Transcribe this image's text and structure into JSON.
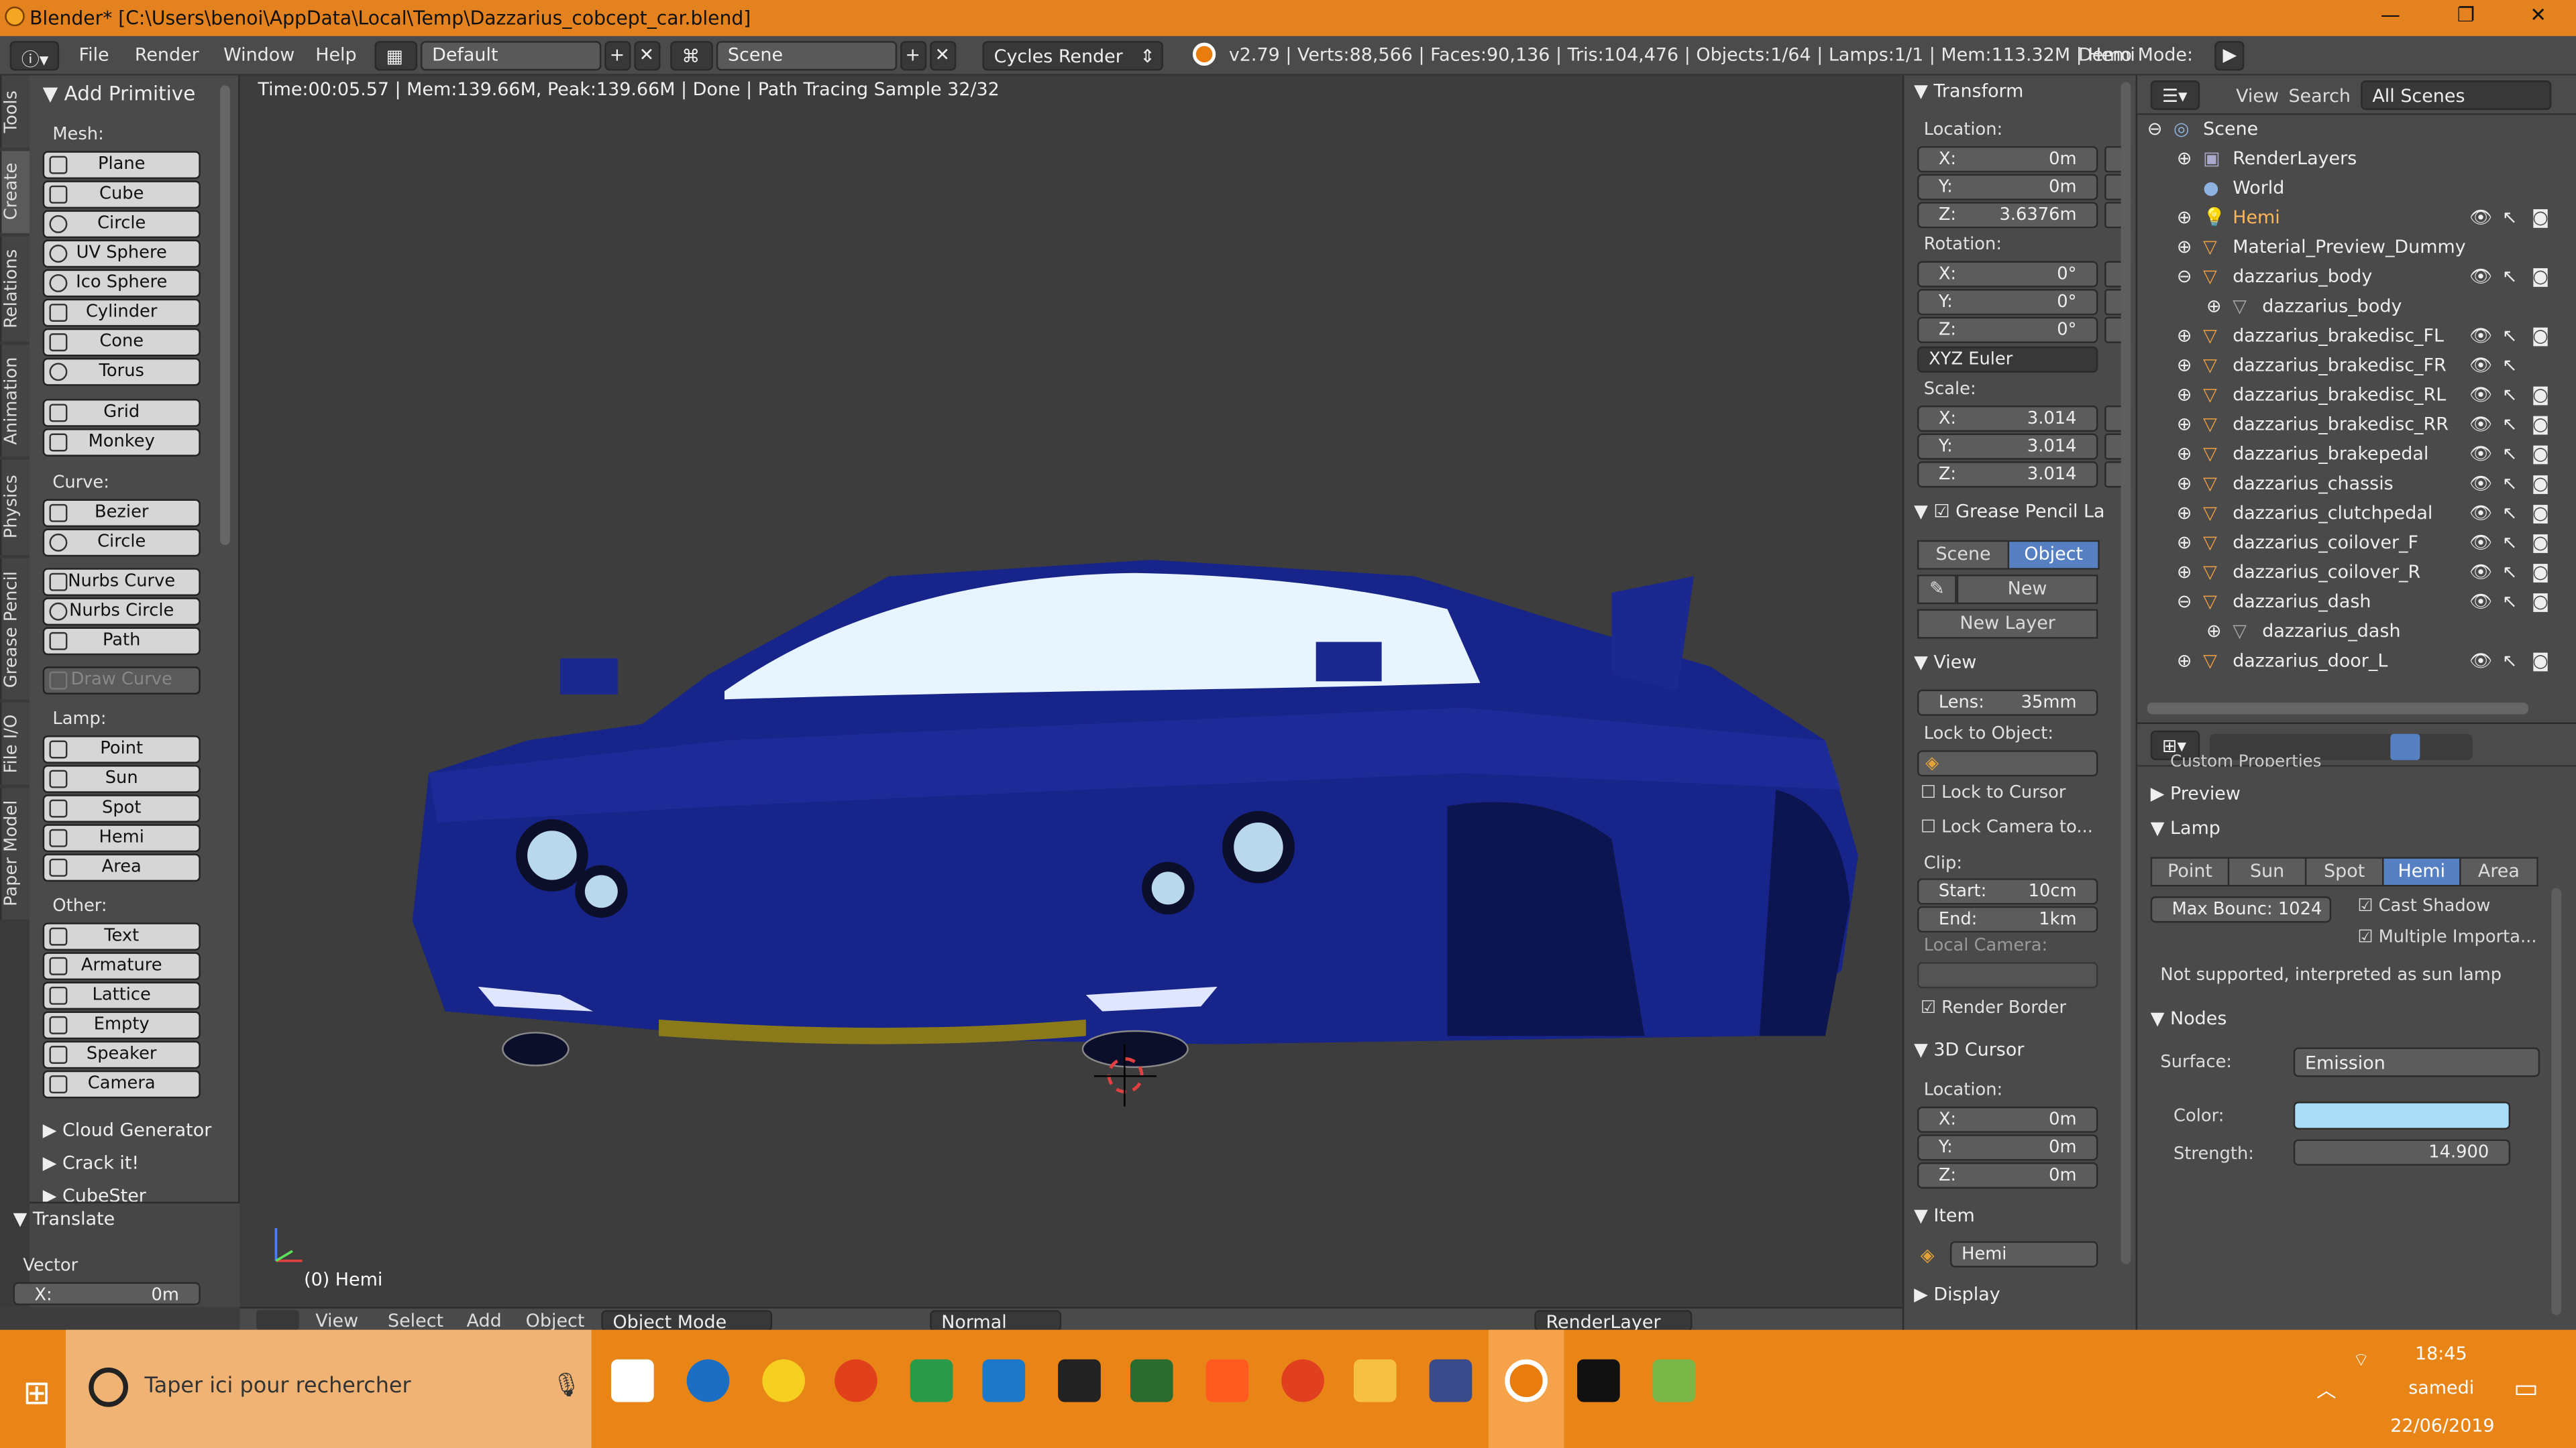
{
  "titlebar": {
    "title": "Blender* [C:\\Users\\benoi\\AppData\\Local\\Temp\\Dazzarius_cobcept_car.blend]",
    "minimize": "—",
    "maximize": "❐",
    "close": "✕"
  },
  "menu": {
    "items": [
      "File",
      "Render",
      "Window",
      "Help"
    ],
    "layout": "Default",
    "scene": "Scene",
    "engine": "Cycles Render",
    "stats": "v2.79 | Verts:88,566 | Faces:90,136 | Tris:104,476 | Objects:1/64 | Lamps:1/1 | Mem:113.32M | Hemi",
    "demo_label": "Demo Mode:"
  },
  "tabs": [
    "Tools",
    "Create",
    "Relations",
    "Animation",
    "Physics",
    "Grease Pencil",
    "File I/O",
    "Paper Model"
  ],
  "toolshelf": {
    "header": "Add Primitive",
    "mesh_label": "Mesh:",
    "mesh": [
      "Plane",
      "Cube",
      "Circle",
      "UV Sphere",
      "Ico Sphere",
      "Cylinder",
      "Cone",
      "Torus"
    ],
    "mesh2": [
      "Grid",
      "Monkey"
    ],
    "curve_label": "Curve:",
    "curve": [
      "Bezier",
      "Circle"
    ],
    "curve2": [
      "Nurbs Curve",
      "Nurbs Circle",
      "Path"
    ],
    "draw_curve": "Draw Curve",
    "lamp_label": "Lamp:",
    "lamp": [
      "Point",
      "Sun",
      "Spot",
      "Hemi",
      "Area"
    ],
    "other_label": "Other:",
    "other": [
      "Text",
      "Armature",
      "Lattice",
      "Empty",
      "Speaker",
      "Camera"
    ],
    "addons": [
      "Cloud Generator",
      "Crack it!",
      "CubeSter"
    ],
    "translate": "Translate",
    "vector_label": "Vector",
    "vector_x": "X:",
    "vector_x_val": "0m"
  },
  "viewport": {
    "info": "Time:00:05.57 | Mem:139.66M, Peak:139.66M | Done | Path Tracing Sample 32/32",
    "object": "(0) Hemi"
  },
  "vp_header": {
    "items": [
      "View",
      "Select",
      "Add",
      "Object"
    ],
    "mode": "Object Mode",
    "shading": "Normal",
    "renderlayer": "RenderLayer"
  },
  "npanel": {
    "transform": "Transform",
    "location": "Location:",
    "loc": [
      [
        "X:",
        "0m"
      ],
      [
        "Y:",
        "0m"
      ],
      [
        "Z:",
        "3.6376m"
      ]
    ],
    "rotation": "Rotation:",
    "rot": [
      [
        "X:",
        "0°"
      ],
      [
        "Y:",
        "0°"
      ],
      [
        "Z:",
        "0°"
      ]
    ],
    "euler": "XYZ Euler",
    "scale": "Scale:",
    "scl": [
      [
        "X:",
        "3.014"
      ],
      [
        "Y:",
        "3.014"
      ],
      [
        "Z:",
        "3.014"
      ]
    ],
    "grease": "Grease Pencil La",
    "gp_scene": "Scene",
    "gp_object": "Object",
    "gp_new": "New",
    "gp_newlayer": "New Layer",
    "view": "View",
    "lens": "Lens:",
    "lens_val": "35mm",
    "lock_obj": "Lock to Object:",
    "lock_cursor": "Lock to Cursor",
    "lock_camera": "Lock Camera to...",
    "clip": "Clip:",
    "clip_start": "Start:",
    "clip_start_val": "10cm",
    "clip_end": "End:",
    "clip_end_val": "1km",
    "local_camera": "Local Camera:",
    "render_border": "Render Border",
    "cursor": "3D Cursor",
    "cursor_loc": "Location:",
    "cur": [
      [
        "X:",
        "0m"
      ],
      [
        "Y:",
        "0m"
      ],
      [
        "Z:",
        "0m"
      ]
    ],
    "item": "Item",
    "item_name": "Hemi",
    "display": "Display"
  },
  "outliner": {
    "view": "View",
    "search": "Search",
    "scenes": "All Scenes",
    "rows": [
      {
        "name": "Scene",
        "indent": 0
      },
      {
        "name": "RenderLayers",
        "indent": 1
      },
      {
        "name": "World",
        "indent": 1
      },
      {
        "name": "Hemi",
        "indent": 1
      },
      {
        "name": "Material_Preview_Dummy",
        "indent": 1
      },
      {
        "name": "dazzarius_body",
        "indent": 1
      },
      {
        "name": "dazzarius_body",
        "indent": 2
      },
      {
        "name": "dazzarius_brakedisc_FL",
        "indent": 1
      },
      {
        "name": "dazzarius_brakedisc_FR",
        "indent": 1
      },
      {
        "name": "dazzarius_brakedisc_RL",
        "indent": 1
      },
      {
        "name": "dazzarius_brakedisc_RR",
        "indent": 1
      },
      {
        "name": "dazzarius_brakepedal",
        "indent": 1
      },
      {
        "name": "dazzarius_chassis",
        "indent": 1
      },
      {
        "name": "dazzarius_clutchpedal",
        "indent": 1
      },
      {
        "name": "dazzarius_coilover_F",
        "indent": 1
      },
      {
        "name": "dazzarius_coilover_R",
        "indent": 1
      },
      {
        "name": "dazzarius_dash",
        "indent": 1
      },
      {
        "name": "dazzarius_dash",
        "indent": 2
      },
      {
        "name": "dazzarius_door_L",
        "indent": 1
      }
    ]
  },
  "props": {
    "custom": "Custom Properties",
    "preview": "Preview",
    "lamp": "Lamp",
    "lamp_types": [
      "Point",
      "Sun",
      "Spot",
      "Hemi",
      "Area"
    ],
    "max_bounce": "Max Bounc: 1024",
    "cast_shadow": "Cast Shadow",
    "multiple": "Multiple Importa...",
    "note": "Not supported, interpreted as sun lamp",
    "nodes": "Nodes",
    "surface_label": "Surface:",
    "surface": "Emission",
    "color_label": "Color:",
    "strength_label": "Strength:",
    "strength": "14.900",
    "color": "#a9dcf7"
  },
  "taskbar": {
    "search": "Taper ici pour rechercher",
    "time": "18:45",
    "day": "samedi",
    "date": "22/06/2019"
  }
}
